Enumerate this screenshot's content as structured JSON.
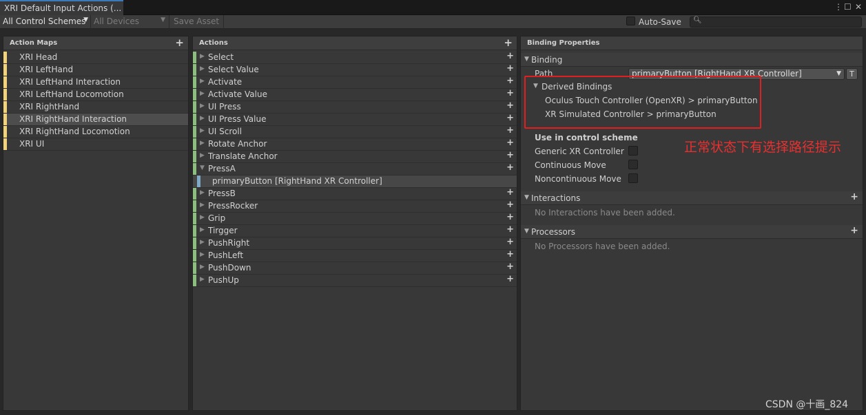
{
  "window": {
    "tab_title": "XRI Default Input Actions (...",
    "menu_icon": "⋮",
    "maximize_icon": "☐",
    "close_icon": "✕"
  },
  "toolbar": {
    "control_schemes": "All Control Schemes",
    "devices": "All Devices",
    "save_asset": "Save Asset",
    "auto_save": "Auto-Save",
    "search_value": ""
  },
  "action_maps": {
    "title": "Action Maps",
    "items": [
      {
        "label": "XRI Head"
      },
      {
        "label": "XRI LeftHand"
      },
      {
        "label": "XRI LeftHand Interaction"
      },
      {
        "label": "XRI LeftHand Locomotion"
      },
      {
        "label": "XRI RightHand"
      },
      {
        "label": "XRI RightHand Interaction",
        "selected": true
      },
      {
        "label": "XRI RightHand Locomotion"
      },
      {
        "label": "XRI UI"
      }
    ]
  },
  "actions": {
    "title": "Actions",
    "items": [
      {
        "label": "Select"
      },
      {
        "label": "Select Value"
      },
      {
        "label": "Activate"
      },
      {
        "label": "Activate Value"
      },
      {
        "label": "UI Press"
      },
      {
        "label": "UI Press Value"
      },
      {
        "label": "UI Scroll"
      },
      {
        "label": "Rotate Anchor"
      },
      {
        "label": "Translate Anchor"
      },
      {
        "label": "PressA",
        "expanded": true
      },
      {
        "label": "primaryButton [RightHand XR Controller]",
        "binding": true
      },
      {
        "label": "PressB"
      },
      {
        "label": "PressRocker"
      },
      {
        "label": "Grip"
      },
      {
        "label": "Tirgger"
      },
      {
        "label": "PushRight"
      },
      {
        "label": "PushLeft"
      },
      {
        "label": "PushDown"
      },
      {
        "label": "PushUp"
      }
    ]
  },
  "binding_properties": {
    "title": "Binding Properties",
    "binding_section": "Binding",
    "path_label": "Path",
    "path_value": "primaryButton [RightHand XR Controller]",
    "t_button": "T",
    "derived_title": "Derived Bindings",
    "derived": [
      "Oculus Touch Controller (OpenXR) > primaryButton",
      "XR Simulated Controller > primaryButton"
    ],
    "use_in_scheme": "Use in control scheme",
    "schemes": [
      {
        "label": "Generic XR Controller",
        "checked": false
      },
      {
        "label": "Continuous Move",
        "checked": false
      },
      {
        "label": "Noncontinuous Move",
        "checked": false
      }
    ],
    "interactions_title": "Interactions",
    "interactions_empty": "No Interactions have been added.",
    "processors_title": "Processors",
    "processors_empty": "No Processors have been added."
  },
  "annotation": {
    "note": "正常状态下有选择路径提示",
    "color": "#e02020"
  },
  "watermark": "CSDN @十画_824",
  "colors": {
    "map_stripe": "#f2d27a",
    "action_stripe": "#8cbe7e",
    "binding_stripe": "#7fa9c4"
  }
}
